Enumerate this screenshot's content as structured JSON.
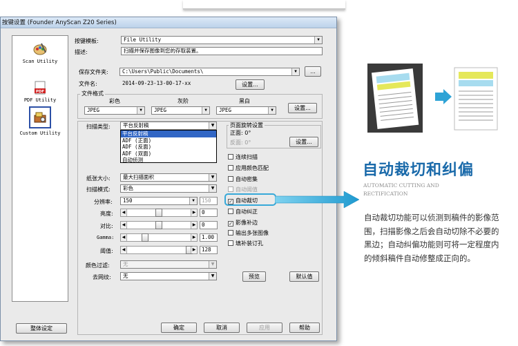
{
  "dialog": {
    "title": "按键设置 (Founder AnyScan Z20 Series)",
    "tools": [
      {
        "label": "Scan Utility",
        "icon": "palette-icon"
      },
      {
        "label": "PDF Utility",
        "icon": "pdf-icon"
      },
      {
        "label": "Custom Utility",
        "icon": "custom-tool-icon"
      }
    ],
    "template_label": "按键模板:",
    "template_value": "File Utility",
    "desc_label": "描述:",
    "desc_value": "扫描并保存图像到您的存取装置。",
    "save_folder_label": "保存文件夹:",
    "save_folder_value": "C:\\Users\\Public\\Documents\\",
    "browse_label": "...",
    "filename_label": "文件名:",
    "filename_value": "2014-09-23-13-00-17-xx",
    "settings_label": "设置...",
    "file_format": {
      "title": "文件格式",
      "color_label": "彩色",
      "gray_label": "灰阶",
      "bw_label": "黑白",
      "color_value": "JPEG",
      "gray_value": "JPEG",
      "bw_value": "JPEG"
    },
    "scan_type_label": "扫描类型:",
    "scan_type_value": "平台反射稿",
    "scan_type_options": [
      "平台反射稿",
      "ADF (正面)",
      "ADF (反面)",
      "ADF (双面)",
      "自动侦测"
    ],
    "rotation": {
      "title": "页面旋转设置",
      "front": "正面: 0°",
      "back": "反面: 0°",
      "settings_label": "设置..."
    },
    "paper_size_label": "纸张大小:",
    "paper_size_value": "最大扫描面积",
    "scan_mode_label": "扫描模式:",
    "scan_mode_value": "彩色",
    "resolution_label": "分辨率:",
    "resolution_value": "150",
    "resolution_box": "150",
    "brightness_label": "亮度:",
    "brightness_value": "0",
    "contrast_label": "对比:",
    "contrast_value": "0",
    "gamma_label": "Gamma:",
    "gamma_value": "1.00",
    "threshold_label": "阈值:",
    "threshold_value": "128",
    "color_filter_label": "颜色过滤:",
    "color_filter_value": "无",
    "descreen_label": "去网纹:",
    "descreen_value": "无",
    "checkboxes": [
      {
        "label": "连续扫描",
        "checked": false,
        "disabled": false
      },
      {
        "label": "应用颜色匹配",
        "checked": false,
        "disabled": false
      },
      {
        "label": "自动密集",
        "checked": false,
        "disabled": false
      },
      {
        "label": "自动阈值",
        "checked": false,
        "disabled": true
      },
      {
        "label": "自动裁切",
        "checked": true,
        "disabled": false
      },
      {
        "label": "自动纠正",
        "checked": false,
        "disabled": false
      },
      {
        "label": "影像补边",
        "checked": true,
        "disabled": false
      },
      {
        "label": "输出多张图像",
        "checked": false,
        "disabled": false
      },
      {
        "label": "填补装订孔",
        "checked": false,
        "disabled": false
      }
    ],
    "preview_label": "预览",
    "default_label": "默认值",
    "overall_label": "整体设定",
    "ok_label": "确定",
    "cancel_label": "取消",
    "apply_label": "应用",
    "help_label": "帮助"
  },
  "feature": {
    "heading": "自动裁切和纠偏",
    "subtitle": "AUTOMATIC CUTTING AND\nRECTIFICATION",
    "description": "自动裁切功能可以侦测到稿件的影像范围，扫描影像之后会自动切除不必要的黑边；自动纠偏功能则可将一定程度内的倾斜稿件自动修整成正向的。"
  },
  "colors": {
    "heading": "#1a6aaa",
    "callout": "#36a8d8",
    "highlight": "#3166c5"
  }
}
